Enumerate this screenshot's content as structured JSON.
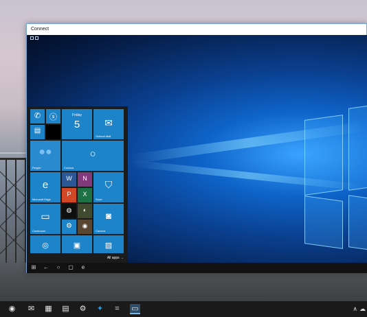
{
  "window": {
    "title": "Connect"
  },
  "start_menu": {
    "tiles": {
      "calendar_day": "Friday",
      "calendar_date": "5",
      "outlook": "Outlook Mail",
      "people": "People",
      "cortana": "Cortana",
      "edge": "Microsoft Edge",
      "store": "Store",
      "continuum": "Continuum",
      "camera": "Camera"
    },
    "all_apps": "All apps"
  },
  "colors": {
    "tile": "#1e84c9",
    "accent": "#76b9ed"
  },
  "icons": {
    "remote_nav": [
      "windows-icon",
      "back-icon",
      "home-icon",
      "task-view-icon",
      "edge-icon"
    ],
    "taskbar": [
      "camera-icon",
      "mail-icon",
      "video-icon",
      "files-icon",
      "settings-icon",
      "twitter-icon",
      "slack-icon",
      "connect-icon"
    ]
  }
}
